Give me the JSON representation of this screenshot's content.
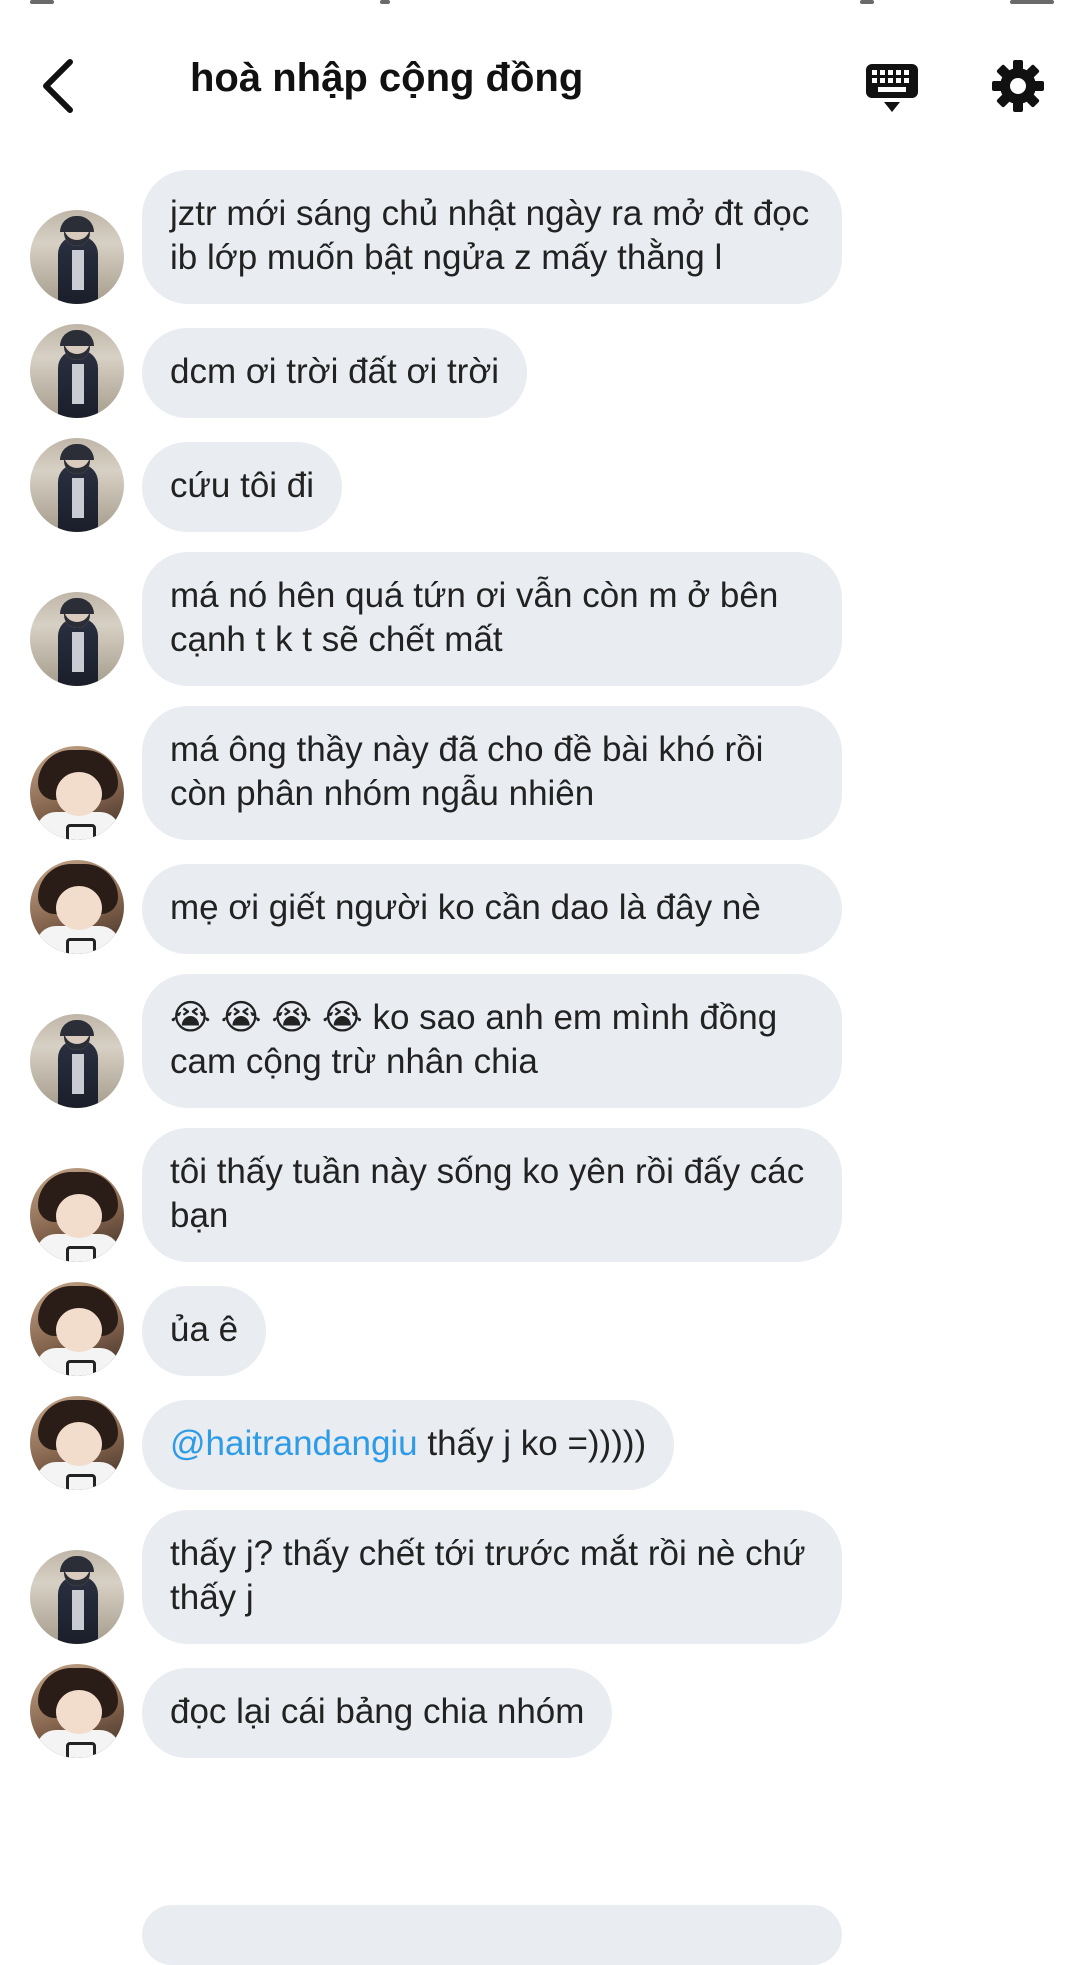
{
  "header": {
    "title": "hoà nhập cộng đồng",
    "back_icon": "chevron-left-icon",
    "keyboard_icon": "keyboard-icon",
    "settings_icon": "gear-icon"
  },
  "messages": [
    {
      "avatar": "a1",
      "text": "jztr mới sáng chủ nhật ngày ra mở đt đọc ib lớp muốn bật ngửa z mấy thằng l"
    },
    {
      "avatar": "a1",
      "text": "dcm ơi trời đất ơi trời"
    },
    {
      "avatar": "a1",
      "text": "cứu tôi đi"
    },
    {
      "avatar": "a1",
      "text": "má nó hên quá tứn ơi vẫn còn m ở bên cạnh t k t sẽ chết mất"
    },
    {
      "avatar": "a2",
      "text": "má ông thầy này đã cho đề bài khó rồi còn phân nhóm ngẫu nhiên"
    },
    {
      "avatar": "a2",
      "text": "mẹ ơi giết người ko cần dao là đây nè"
    },
    {
      "avatar": "a1",
      "emoji": "😭 😭 😭 😭",
      "text": " ko sao anh em mình đồng cam cộng trừ nhân chia"
    },
    {
      "avatar": "a2",
      "text": "tôi thấy tuần này sống ko yên rồi đấy các bạn"
    },
    {
      "avatar": "a2",
      "text": "ủa ê"
    },
    {
      "avatar": "a2",
      "mention": "@haitrandangiu",
      "text": " thấy j ko =)))))"
    },
    {
      "avatar": "a1",
      "text": "thấy j? thấy chết tới trước mắt rồi nè chứ thấy j"
    },
    {
      "avatar": "a2",
      "text": "đọc lại cái bảng chia nhóm"
    }
  ]
}
